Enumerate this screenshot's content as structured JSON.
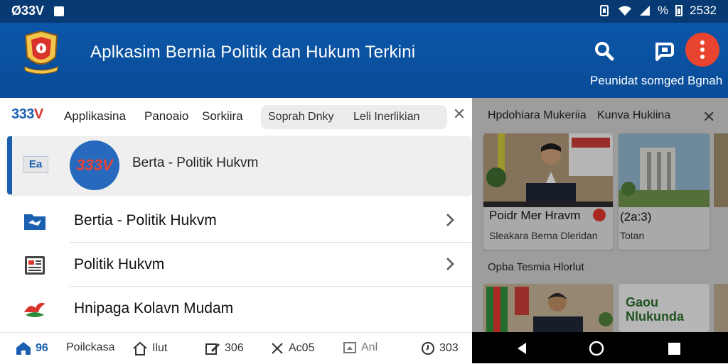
{
  "status_bar": {
    "left_text": "Ø33V",
    "battery_percent": "%",
    "time": "2532"
  },
  "app_bar": {
    "title": "Aplkasim Bernia Politik dan Hukum Terkini",
    "subtitle": "Peunidat somged Bgnah"
  },
  "top_tabs": {
    "brand_prefix": "333",
    "brand_suffix": "V",
    "items": [
      "Applikasina",
      "Panoaio",
      "Sorkiira"
    ],
    "search_chip": [
      "Soprah Dnky",
      "Leli Inerlikian"
    ]
  },
  "selected_item": {
    "small_icon_text": "Ea",
    "avatar_text_prefix": "33",
    "avatar_text_suffix": "3V",
    "label": "Berta - Politik Hukvm"
  },
  "list_items": [
    {
      "label": "Bertia - Politik Hukvm",
      "icon": "folder-icon"
    },
    {
      "label": "Politik Hukvm",
      "icon": "newspaper-icon"
    },
    {
      "label": "Hnipaga Kolavn Mudam",
      "icon": "bird-logo-icon"
    }
  ],
  "bottom_nav": [
    {
      "icon": "home-icon",
      "label": "96"
    },
    {
      "icon": "none",
      "label": "Poilckasa"
    },
    {
      "icon": "house-outline-icon",
      "label": "Ilut"
    },
    {
      "icon": "edit-icon",
      "label": "306"
    },
    {
      "icon": "close-icon",
      "label": "Ac05"
    },
    {
      "icon": "image-icon",
      "label": "Anl"
    },
    {
      "icon": "clock-icon",
      "label": "303"
    }
  ],
  "right_panel": {
    "tabs": [
      "Hpdohiara Mukeriia",
      "Kunva Hukiina"
    ],
    "cards": [
      {
        "title": "Poidr Mer Hravm",
        "subtitle": "Sleakara Berna Dleridan"
      },
      {
        "title": "(2a:3)",
        "subtitle": "Totan"
      }
    ],
    "section_title": "Opba Tesmia Hlorlut",
    "promo_line1": "Gaou",
    "promo_line2": "Nlukunda"
  },
  "colors": {
    "status_bar": "#073a72",
    "app_bar": "#0b56a8",
    "accent": "#1b5fb0",
    "menu_button": "#e8442f"
  }
}
